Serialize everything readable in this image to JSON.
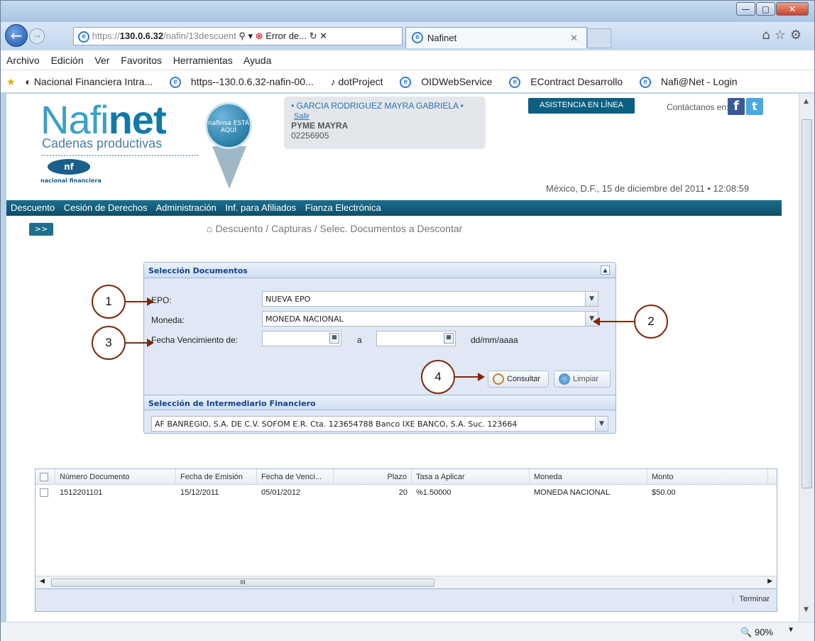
{
  "browser": {
    "address_dim": "https://",
    "address_host": "130.0.6.32",
    "address_path": "/nafin/13descuent",
    "address_error": "Error de...",
    "tab_title": "Nafinet"
  },
  "menu": [
    "Archivo",
    "Edición",
    "Ver",
    "Favoritos",
    "Herramientas",
    "Ayuda"
  ],
  "favorites": [
    "Nacional Financiera Intra...",
    "https--130.0.6.32-nafin-00...",
    "dotProject",
    "OIDWebService",
    "EContract Desarrollo",
    "Nafi@Net - Login"
  ],
  "header": {
    "logo_a": "Nafi",
    "logo_b": "net",
    "logo_sub": "Cadenas productivas",
    "nfin_text": "nacional financiera",
    "pin_text": "nafinsa ESTÁ AQUÍ",
    "user_name": "GARCIA RODRIGUEZ MAYRA GABRIELA",
    "logout": "Salir",
    "user_company": "PYME MAYRA",
    "user_code": "02256905",
    "assist": "ASISTENCIA EN LÍNEA",
    "contact": "Contáctanos en:",
    "date": "México, D.F., 15 de diciembre del 2011 • 12:08:59"
  },
  "site_nav": [
    "Descuento",
    "Cesión de Derechos",
    "Administración",
    "Inf. para Afiliados",
    "Fianza Electrónica"
  ],
  "expander": ">>",
  "breadcrumb": "Descuento / Capturas / Selec. Documentos a Descontar",
  "form": {
    "title": "Selección Documentos",
    "epo_label": "EPO:",
    "epo_value": "NUEVA EPO",
    "moneda_label": "Moneda:",
    "moneda_value": "MONEDA NACIONAL",
    "fecha_label": "Fecha Vencimiento de:",
    "fecha_from": "",
    "fecha_a": "a",
    "fecha_to": "",
    "fecha_format": "dd/mm/aaaa",
    "consultar": "Consultar",
    "limpiar": "Limpiar",
    "interm_title": "Selección de Intermediario Financiero",
    "interm_value": "AF BANREGIO, S.A. DE C.V. SOFOM E.R. Cta. 123654788 Banco IXE BANCO, S.A. Suc. 123664"
  },
  "callouts": [
    "1",
    "2",
    "3",
    "4"
  ],
  "grid": {
    "columns": [
      "Número Documento",
      "Fecha de Emisión",
      "Fecha de Venci...",
      "Plazo",
      "Tasa a Aplicar",
      "Moneda",
      "Monto"
    ],
    "rows": [
      [
        "1512201101",
        "15/12/2011",
        "05/01/2012",
        "20",
        "%1.50000",
        "MONEDA NACIONAL",
        "$50.00"
      ]
    ],
    "scroll_mark": "III",
    "footer_button": "Terminar"
  },
  "status": {
    "zoom": "90%"
  },
  "colors": {
    "nav_bar": "#0c4f68",
    "panel_header": "#15428b",
    "callout": "#7b2a0c"
  }
}
